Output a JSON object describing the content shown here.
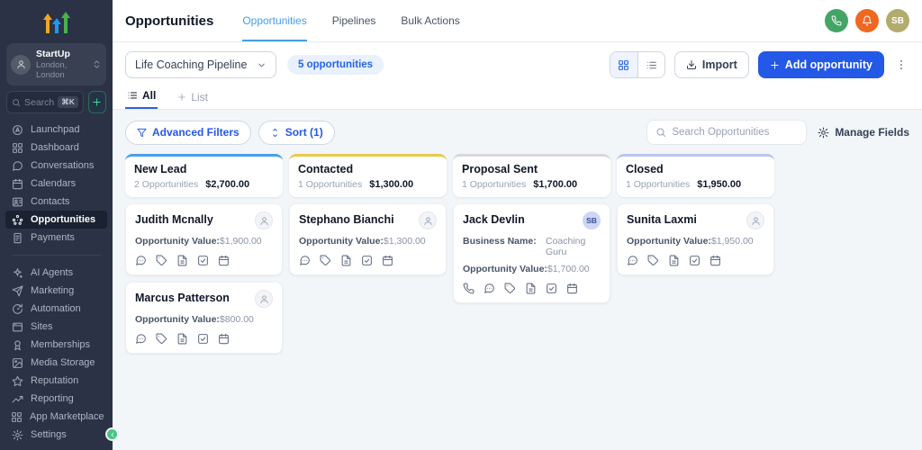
{
  "sidebar": {
    "agency": {
      "name": "StartUp",
      "location": "London, London"
    },
    "search": {
      "placeholder": "Search",
      "shortcut": "⌘K"
    },
    "items": [
      {
        "label": "Launchpad",
        "icon": "launchpad",
        "active": false
      },
      {
        "label": "Dashboard",
        "icon": "dashboard",
        "active": false
      },
      {
        "label": "Conversations",
        "icon": "conversations",
        "active": false
      },
      {
        "label": "Calendars",
        "icon": "calendars",
        "active": false
      },
      {
        "label": "Contacts",
        "icon": "contacts",
        "active": false
      },
      {
        "label": "Opportunities",
        "icon": "opportunities",
        "active": true
      },
      {
        "label": "Payments",
        "icon": "payments",
        "active": false
      }
    ],
    "items2": [
      {
        "label": "AI Agents",
        "icon": "ai-agents"
      },
      {
        "label": "Marketing",
        "icon": "marketing"
      },
      {
        "label": "Automation",
        "icon": "automation"
      },
      {
        "label": "Sites",
        "icon": "sites"
      },
      {
        "label": "Memberships",
        "icon": "memberships"
      },
      {
        "label": "Media Storage",
        "icon": "media-storage"
      },
      {
        "label": "Reputation",
        "icon": "reputation"
      },
      {
        "label": "Reporting",
        "icon": "reporting"
      },
      {
        "label": "App Marketplace",
        "icon": "app-marketplace"
      }
    ],
    "settings_label": "Settings"
  },
  "header": {
    "title": "Opportunities",
    "tabs": [
      {
        "label": "Opportunities",
        "active": true
      },
      {
        "label": "Pipelines",
        "active": false
      },
      {
        "label": "Bulk Actions",
        "active": false
      }
    ],
    "avatar_initials": "SB"
  },
  "toolbar": {
    "pipeline": "Life Coaching Pipeline",
    "count_badge": "5 opportunities",
    "import_label": "Import",
    "add_label": "Add opportunity"
  },
  "view_tabs": {
    "all_label": "All",
    "list_label": "List"
  },
  "filters": {
    "advanced_label": "Advanced Filters",
    "sort_label": "Sort (1)",
    "search_placeholder": "Search Opportunities",
    "manage_fields_label": "Manage Fields"
  },
  "board": {
    "columns": [
      {
        "name": "New Lead",
        "count": "2 Opportunities",
        "value": "$2,700.00",
        "color": "#4a9ee8",
        "cards": [
          {
            "name": "Judith Mcnally",
            "avatar": "person",
            "fields": [
              {
                "label": "Opportunity Value:",
                "value": "$1,900.00"
              }
            ],
            "icons": [
              "message-icon",
              "tag-icon",
              "file-icon",
              "task-icon",
              "calendar-icon"
            ]
          },
          {
            "name": "Marcus Patterson",
            "avatar": "person",
            "fields": [
              {
                "label": "Opportunity Value:",
                "value": "$800.00"
              }
            ],
            "icons": [
              "message-icon",
              "tag-icon",
              "file-icon",
              "task-icon",
              "calendar-icon"
            ]
          }
        ]
      },
      {
        "name": "Contacted",
        "count": "1 Opportunities",
        "value": "$1,300.00",
        "color": "#eac94d",
        "cards": [
          {
            "name": "Stephano Bianchi",
            "avatar": "person",
            "fields": [
              {
                "label": "Opportunity Value:",
                "value": "$1,300.00"
              }
            ],
            "icons": [
              "message-icon",
              "tag-icon",
              "file-icon",
              "task-icon",
              "calendar-icon"
            ]
          }
        ]
      },
      {
        "name": "Proposal Sent",
        "count": "1 Opportunities",
        "value": "$1,700.00",
        "color": "#d8d6de",
        "cards": [
          {
            "name": "Jack Devlin",
            "avatar": "SB",
            "fields": [
              {
                "label": "Business Name:",
                "value": "Coaching Guru"
              },
              {
                "label": "Opportunity Value:",
                "value": "$1,700.00"
              }
            ],
            "icons": [
              "phone-icon",
              "message-icon",
              "tag-icon",
              "file-icon",
              "task-icon",
              "calendar-icon"
            ]
          }
        ]
      },
      {
        "name": "Closed",
        "count": "1 Opportunities",
        "value": "$1,950.00",
        "color": "#b9c5ec",
        "cards": [
          {
            "name": "Sunita Laxmi",
            "avatar": "person",
            "fields": [
              {
                "label": "Opportunity Value:",
                "value": "$1,950.00"
              }
            ],
            "icons": [
              "message-icon",
              "tag-icon",
              "file-icon",
              "task-icon",
              "calendar-icon"
            ]
          }
        ]
      }
    ]
  },
  "colors": {
    "accent_blue": "#2458e6",
    "tab_blue": "#459fe8",
    "sidebar_bg": "#2b3245",
    "phone_green": "#43a565",
    "bell_orange": "#ef6820",
    "avatar_tan": "#b3ab6e"
  }
}
